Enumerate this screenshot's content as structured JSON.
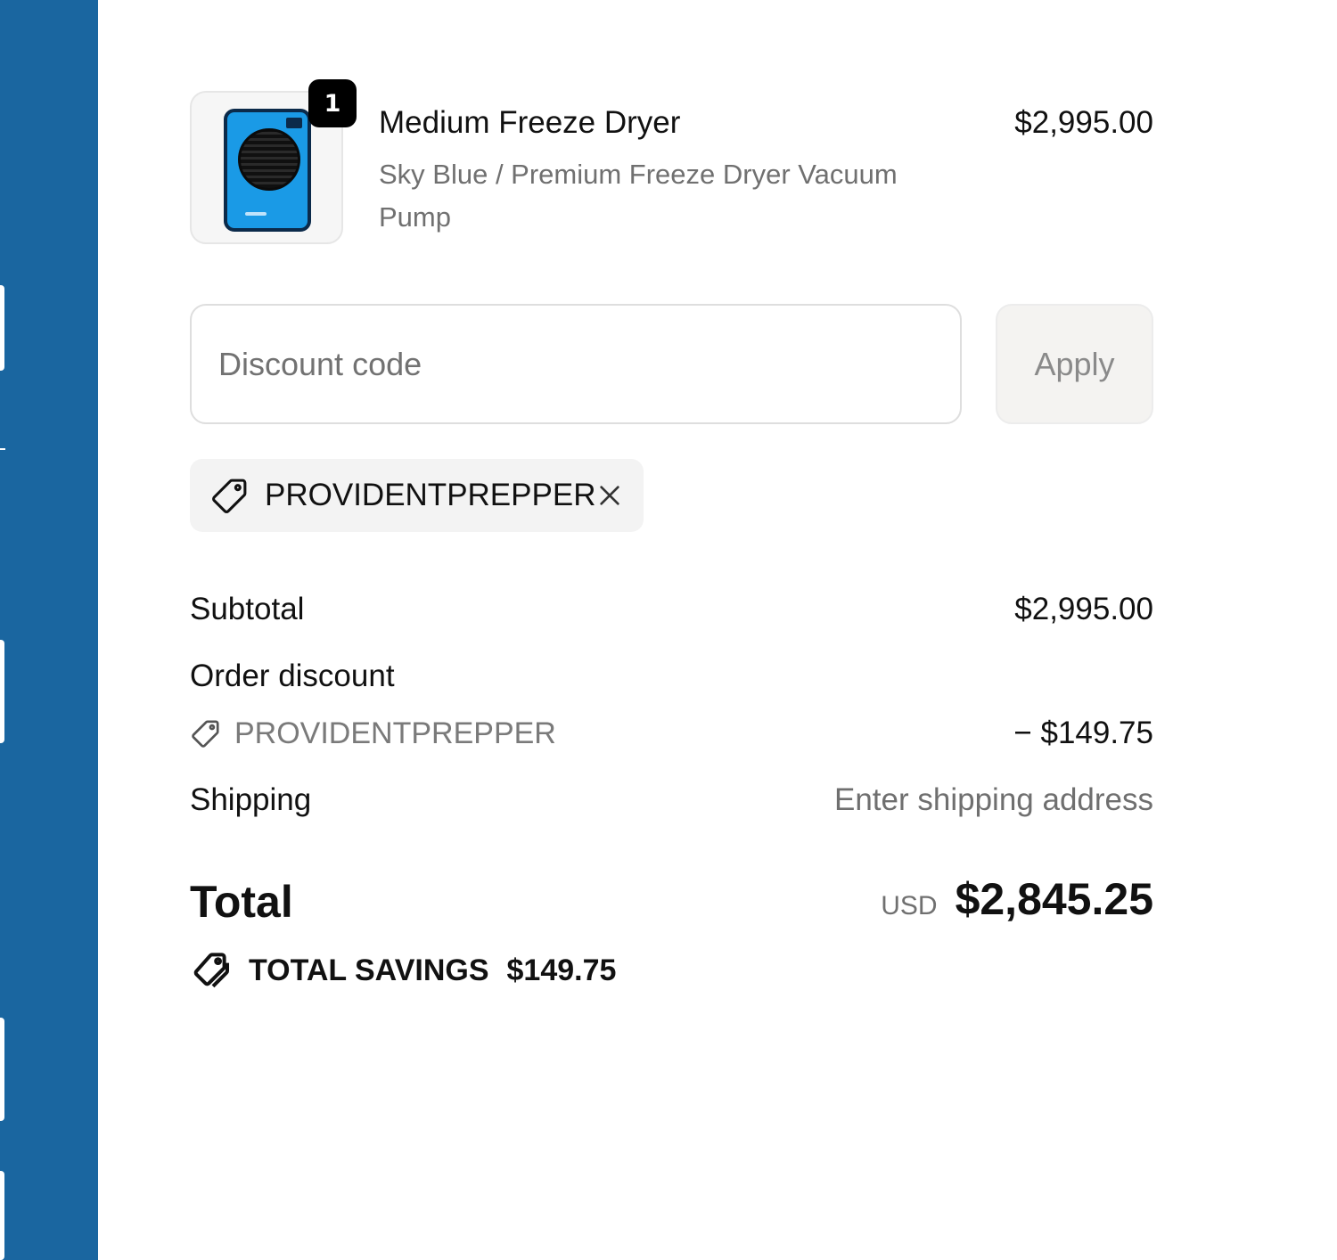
{
  "product": {
    "quantity": "1",
    "name": "Medium Freeze Dryer",
    "variant": "Sky Blue / Premium Freeze Dryer Vacuum Pump",
    "price": "$2,995.00",
    "image_color": "#1a9ae6"
  },
  "discount": {
    "placeholder": "Discount code",
    "value": "",
    "apply_label": "Apply",
    "applied_code": "PROVIDENTPREPPER"
  },
  "summary": {
    "subtotal_label": "Subtotal",
    "subtotal_value": "$2,995.00",
    "order_discount_label": "Order discount",
    "discount_code": "PROVIDENTPREPPER",
    "discount_value": "− $149.75",
    "shipping_label": "Shipping",
    "shipping_value": "Enter shipping address",
    "total_label": "Total",
    "currency": "USD",
    "total_value": "$2,845.25",
    "savings_label": "TOTAL SAVINGS",
    "savings_value": "$149.75"
  },
  "colors": {
    "sidebar": "#1a66a0",
    "muted_text": "#707070",
    "apply_bg": "#f4f3f1",
    "chip_bg": "#f3f3f3"
  },
  "icons": [
    "tag-icon",
    "close-icon",
    "tags-icon"
  ]
}
